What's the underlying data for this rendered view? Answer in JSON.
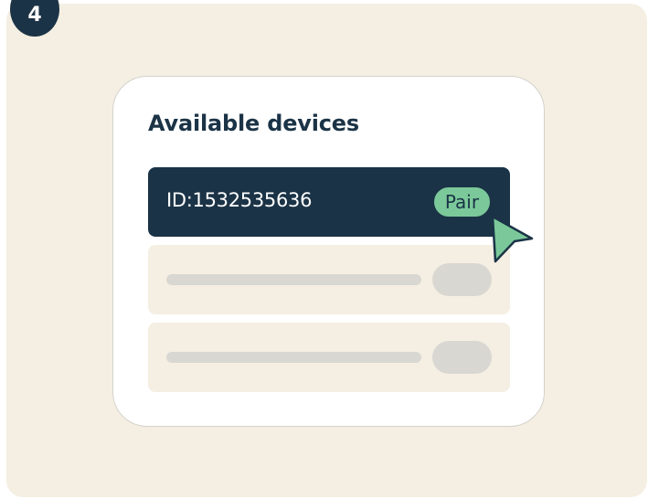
{
  "step": {
    "number": "4"
  },
  "card": {
    "title": "Available devices",
    "devices": [
      {
        "id": "ID:1532535636",
        "action_label": "Pair",
        "selected": true
      }
    ],
    "placeholder_rows": 2
  },
  "colors": {
    "background": "#f4efe2",
    "navy": "#1b3346",
    "accent_green": "#7bc99a",
    "placeholder_gray": "#d9d7d2",
    "card": "#ffffff"
  },
  "icons": {
    "cursor": "mouse-pointer-icon"
  }
}
